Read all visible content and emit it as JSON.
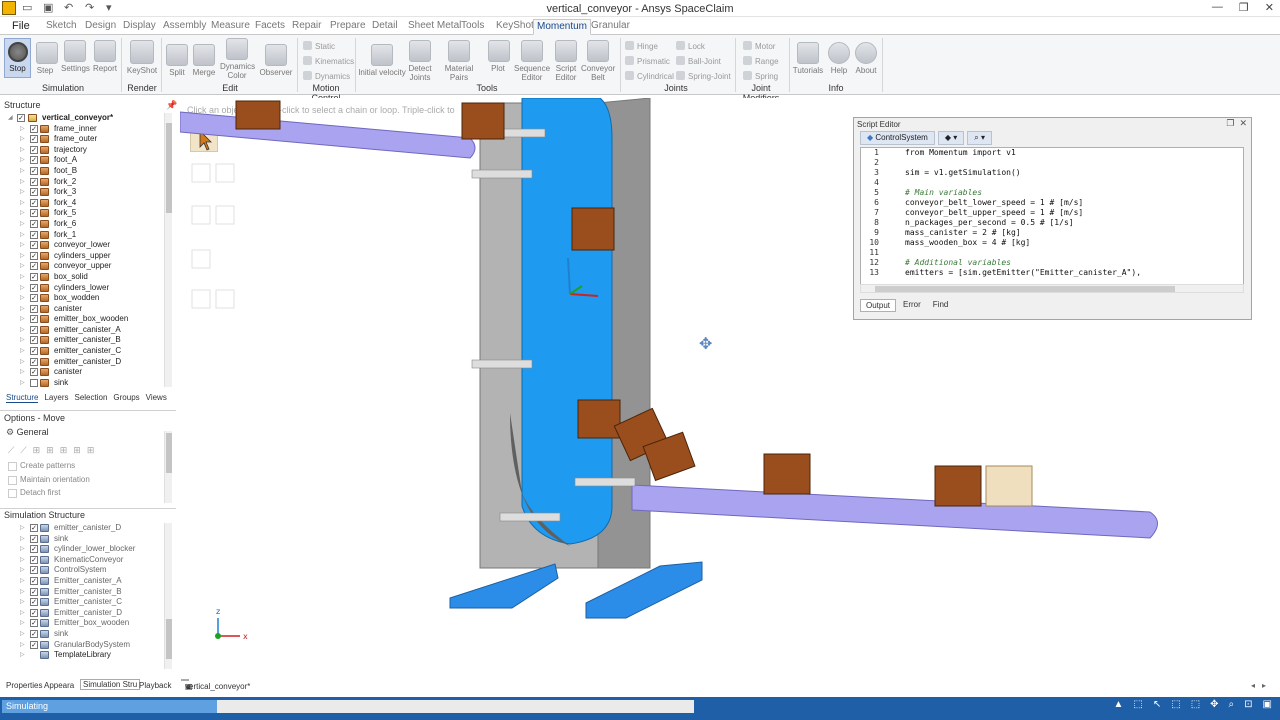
{
  "window": {
    "title": "vertical_conveyor - Ansys SpaceClaim",
    "file_tab": "File",
    "min_glyph": "—",
    "max_glyph": "❐",
    "close_glyph": "✕"
  },
  "ribbon_tabs": [
    "Sketch",
    "Design",
    "Display",
    "Assembly",
    "Measure",
    "Facets",
    "Repair",
    "Prepare",
    "Detail",
    "Sheet Metal",
    "Tools",
    "KeyShot",
    "Momentum",
    "Granular"
  ],
  "ribbon": {
    "simulation": {
      "label": "Simulation",
      "stop": "Stop",
      "step": "Step",
      "settings": "Settings",
      "report": "Report"
    },
    "render": {
      "label": "Render",
      "keyshot": "KeyShot"
    },
    "edit": {
      "label": "Edit",
      "split": "Split",
      "merge": "Merge",
      "dynamics_color": "Dynamics Color",
      "observer": "Observer"
    },
    "motion_control": {
      "label": "Motion Control",
      "static": "Static",
      "kinematics": "Kinematics",
      "dynamics": "Dynamics"
    },
    "tools": {
      "label": "Tools",
      "initial_velocity": "Initial velocity",
      "detect_joints": "Detect Joints",
      "material_pairs": "Material Pairs",
      "plot": "Plot",
      "sequence_editor": "Sequence Editor",
      "script_editor": "Script Editor",
      "conveyor_belt": "Conveyor Belt"
    },
    "joints": {
      "label": "Joints",
      "hinge": "Hinge",
      "prismatic": "Prismatic",
      "cylindrical": "Cylindrical",
      "lock": "Lock",
      "ball_joint": "Ball-Joint",
      "spring_joint": "Spring-Joint"
    },
    "joint_modifiers": {
      "label": "Joint Modifiers",
      "motor": "Motor",
      "range": "Range",
      "spring": "Spring"
    },
    "info": {
      "label": "Info",
      "tutorials": "Tutorials",
      "help": "Help",
      "about": "About"
    }
  },
  "structure": {
    "header": "Structure",
    "root": "vertical_conveyor*",
    "items": [
      "frame_inner",
      "frame_outer",
      "trajectory",
      "foot_A",
      "foot_B",
      "fork_2",
      "fork_3",
      "fork_4",
      "fork_5",
      "fork_6",
      "fork_1",
      "conveyor_lower",
      "cylinders_upper",
      "conveyor_upper",
      "box_solid",
      "cylinders_lower",
      "box_wodden",
      "canister",
      "emitter_box_wooden",
      "emitter_canister_A",
      "emitter_canister_B",
      "emitter_canister_C",
      "emitter_canister_D",
      "canister",
      "sink"
    ],
    "tabs": [
      "Structure",
      "Layers",
      "Selection",
      "Groups",
      "Views"
    ]
  },
  "options": {
    "header": "Options - Move",
    "section": "General",
    "items": [
      "Create patterns",
      "Maintain orientation",
      "Detach first"
    ]
  },
  "sim_structure": {
    "header": "Simulation Structure",
    "items": [
      "emitter_canister_D",
      "sink",
      "cylinder_lower_blocker",
      "KinematicConveyor",
      "ControlSystem",
      "Emitter_canister_A",
      "Emitter_canister_B",
      "Emitter_canister_C",
      "Emitter_canister_D",
      "Emitter_box_wooden",
      "sink",
      "GranularBodySystem",
      "TemplateLibrary"
    ]
  },
  "viewport": {
    "hint": "Click an object. Double-click to select a chain or loop. Triple-click to"
  },
  "script_editor": {
    "title": "Script Editor",
    "tab": "ControlSystem",
    "lines": [
      {
        "n": "1",
        "t": "from Momentum import v1",
        "c": false
      },
      {
        "n": "2",
        "t": "",
        "c": false
      },
      {
        "n": "3",
        "t": "sim = v1.getSimulation()",
        "c": false
      },
      {
        "n": "4",
        "t": "",
        "c": false
      },
      {
        "n": "5",
        "t": "# Main variables",
        "c": true
      },
      {
        "n": "6",
        "t": "conveyor_belt_lower_speed = 1 # [m/s]",
        "c": false
      },
      {
        "n": "7",
        "t": "conveyor_belt_upper_speed = 1 # [m/s]",
        "c": false
      },
      {
        "n": "8",
        "t": "n_packages_per_second = 0.5 # [1/s]",
        "c": false
      },
      {
        "n": "9",
        "t": "mass_canister = 2 # [kg]",
        "c": false
      },
      {
        "n": "10",
        "t": "mass_wooden_box = 4 # [kg]",
        "c": false
      },
      {
        "n": "11",
        "t": "",
        "c": false
      },
      {
        "n": "12",
        "t": "# Additional variables",
        "c": true
      },
      {
        "n": "13",
        "t": "emitters = [sim.getEmitter(\"Emitter_canister_A\"),",
        "c": false
      }
    ],
    "bottom_tabs": [
      "Output",
      "Error",
      "Find"
    ]
  },
  "bottom_tabs": {
    "properties": "Properties",
    "appearance": "Appeara",
    "simstructure": "Simulation Stru",
    "playback": "Playback",
    "doc": "vertical_conveyor*"
  },
  "status": {
    "text": "Simulating"
  },
  "colors": {
    "accent": "#1e5fa8",
    "belt": "#a9a3f0",
    "chute": "#1e9bf0",
    "frame": "#a8a8a8",
    "box": "#9a4e1e",
    "feet": "#2b8de8"
  }
}
